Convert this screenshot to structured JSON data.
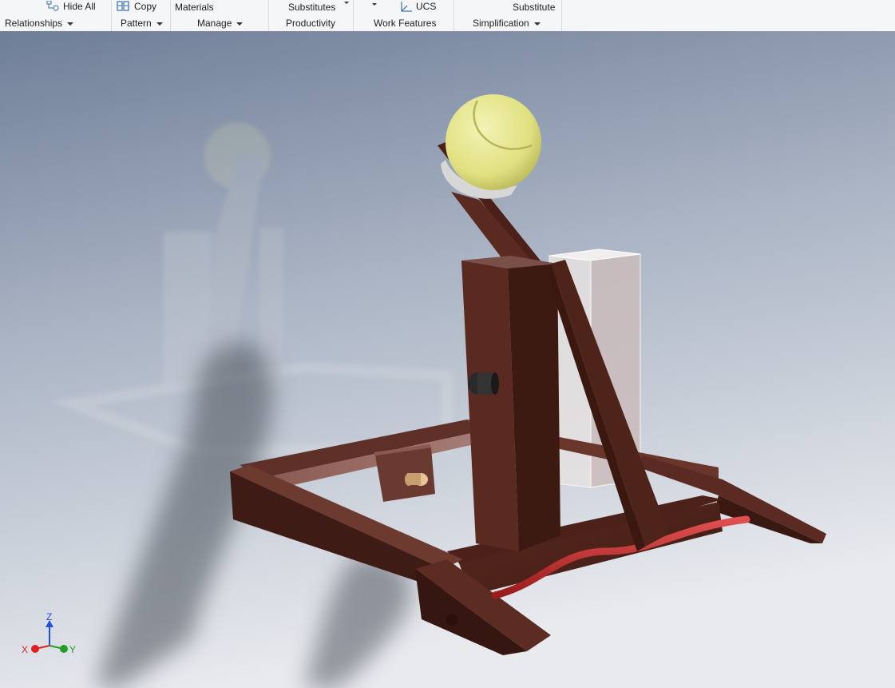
{
  "ribbon": {
    "row1": {
      "hide_all": "Hide All",
      "copy": "Copy",
      "materials": "Materials",
      "substitutes": "Substitutes",
      "ucs": "UCS",
      "substitute": "Substitute"
    },
    "panels": {
      "relationships": "Relationships",
      "pattern": "Pattern",
      "manage": "Manage",
      "productivity": "Productivity",
      "work_features": "Work Features",
      "simplification": "Simplification"
    }
  },
  "view_triad": {
    "x": "X",
    "y": "Y",
    "z": "Z"
  },
  "colors": {
    "wood": "#4a2118",
    "ball": "#e5e58a",
    "ribbon_bg": "#f5f6f7",
    "axis_x": "#e02020",
    "axis_y": "#20a020",
    "axis_z": "#2050e0"
  }
}
